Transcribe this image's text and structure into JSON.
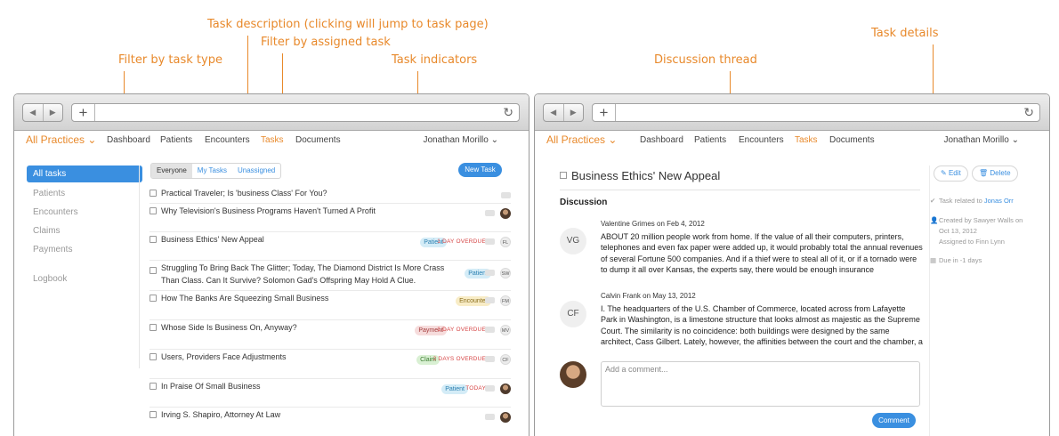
{
  "annotations": {
    "task_description": "Task description (clicking will jump to task page)",
    "filter_assigned": "Filter by assigned task",
    "filter_type": "Filter by task type",
    "task_indicators": "Task indicators",
    "discussion_thread": "Discussion thread",
    "task_details": "Task details"
  },
  "nav": {
    "brand": "All Practices ⌄",
    "items": [
      "Dashboard",
      "Patients",
      "Encounters",
      "Tasks",
      "Documents"
    ],
    "active": "Tasks",
    "user": "Jonathan Morillo ⌄"
  },
  "sidebar": {
    "items": [
      "All tasks",
      "Patients",
      "Encounters",
      "Claims",
      "Payments",
      "Logbook"
    ]
  },
  "filters": [
    "Everyone",
    "My Tasks",
    "Unassigned"
  ],
  "new_task_label": "New Task",
  "tasks": [
    {
      "title": "Practical Traveler; Is 'business Class' For You?",
      "tag": "",
      "overdue": "",
      "avatar": ""
    },
    {
      "title": "Why Television's Business Programs Haven't Turned A Profit",
      "tag": "",
      "overdue": "",
      "avatar": "photo"
    },
    {
      "title": "Business Ethics' New Appeal",
      "tag": "Patient",
      "overdue": "1 DAY OVERDUE",
      "avatar": "FL"
    },
    {
      "title": "Struggling To Bring Back The Glitter; Today, The Diamond District Is More Crass Than Class. Can It Survive? Solomon Gad's Offspring May Hold A Clue.",
      "tag": "Patient",
      "overdue": "",
      "avatar": "SW"
    },
    {
      "title": "How The Banks Are Squeezing Small Business",
      "tag": "Encounter",
      "overdue": "",
      "avatar": "FM"
    },
    {
      "title": "Whose Side Is Business On, Anyway?",
      "tag": "Payment",
      "overdue": "1 DAY OVERDUE",
      "avatar": "MV"
    },
    {
      "title": "Users, Providers Face Adjustments",
      "tag": "Claim",
      "overdue": "2 DAYS OVERDUE",
      "avatar": "CF"
    },
    {
      "title": "In Praise Of Small Business",
      "tag": "Patient",
      "overdue": "TODAY",
      "avatar": "photo"
    },
    {
      "title": "Irving S. Shapiro, Attorney At Law",
      "tag": "",
      "overdue": "",
      "avatar": "photo"
    }
  ],
  "tag_colors": {
    "Patient": {
      "bg": "#d4ecf7",
      "fg": "#2a7fb0"
    },
    "Encounter": {
      "bg": "#f8ecc6",
      "fg": "#8a6d1c"
    },
    "Payment": {
      "bg": "#f6dcdc",
      "fg": "#a33b3b"
    },
    "Claim": {
      "bg": "#d9f0d3",
      "fg": "#3d7d31"
    }
  },
  "detail": {
    "title": "Business Ethics' New Appeal",
    "discussion_heading": "Discussion",
    "comments": [
      {
        "initials": "VG",
        "meta": "Valentine Grimes on Feb 4, 2012",
        "text": "ABOUT 20 million people work from home. If the value of all their computers, printers, telephones and even fax paper were added up, it would probably total the annual revenues of several Fortune 500 companies. And if a thief were to steal all of it, or if a tornado were to dump it all over Kansas, the experts say, there would be enough insurance"
      },
      {
        "initials": "CF",
        "meta": "Calvin Frank on May 13, 2012",
        "text": "I. The headquarters of the U.S. Chamber of Commerce, located across from Lafayette Park in Washington, is a limestone structure that looks almost as majestic as the Supreme Court. The similarity is no coincidence: both buildings were designed by the same architect, Cass Gilbert. Lately, however, the affinities between the court and the chamber, a"
      }
    ],
    "comment_placeholder": "Add a comment...",
    "comment_button": "Comment",
    "edit_label": "Edit",
    "delete_label": "Delete",
    "related_prefix": "Task related to",
    "related_name": "Jonas Orr",
    "created_line1": "Created by Sawyer Walls on",
    "created_line2": "Oct 13, 2012",
    "created_line3": "Assigned to Finn Lynn",
    "due": "Due in -1 days"
  },
  "colors": {
    "accent": "#e8892b",
    "primary": "#3a8fe0",
    "overdue": "#d64545"
  }
}
